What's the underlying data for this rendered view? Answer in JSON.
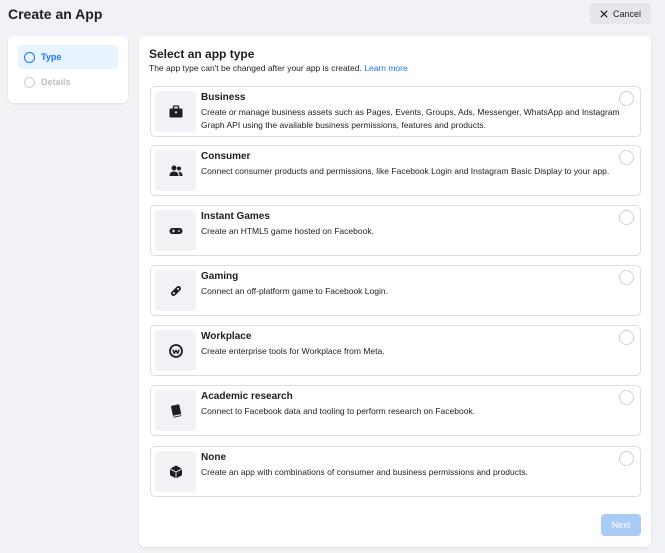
{
  "header": {
    "title": "Create an App",
    "cancel_label": "Cancel"
  },
  "steps": [
    {
      "label": "Type",
      "state": "active"
    },
    {
      "label": "Details",
      "state": "inactive"
    }
  ],
  "main": {
    "title": "Select an app type",
    "subtitle": "The app type can't be changed after your app is created.",
    "learn_more": "Learn more",
    "options": [
      {
        "title": "Business",
        "description": "Create or manage business assets such as Pages, Events, Groups, Ads, Messenger, WhatsApp and Instagram Graph API using the available business permissions, features and products.",
        "icon": "briefcase-icon",
        "selected": false
      },
      {
        "title": "Consumer",
        "description": "Connect consumer products and permissions, like Facebook Login and Instagram Basic Display to your app.",
        "icon": "people-icon",
        "selected": false
      },
      {
        "title": "Instant Games",
        "description": "Create an HTML5 game hosted on Facebook.",
        "icon": "gamepad-icon",
        "selected": false
      },
      {
        "title": "Gaming",
        "description": "Connect an off-platform game to Facebook Login.",
        "icon": "joystick-icon",
        "selected": false
      },
      {
        "title": "Workplace",
        "description": "Create enterprise tools for Workplace from Meta.",
        "icon": "workplace-icon",
        "selected": false
      },
      {
        "title": "Academic research",
        "description": "Connect to Facebook data and tooling to perform research on Facebook.",
        "icon": "book-icon",
        "selected": false
      },
      {
        "title": "None",
        "description": "Create an app with combinations of consumer and business permissions and products.",
        "icon": "cube-icon",
        "selected": false
      }
    ],
    "next_label": "Next"
  },
  "colors": {
    "accent": "#1877f2",
    "background": "#f0f2f5",
    "next_disabled": "#a9ccf7"
  }
}
